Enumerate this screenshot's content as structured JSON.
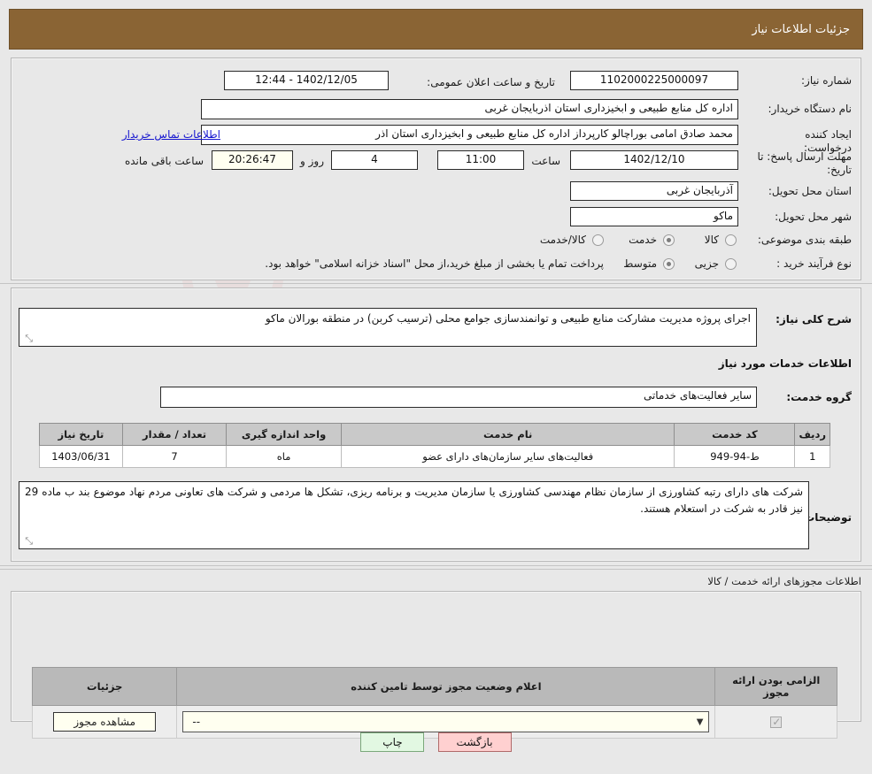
{
  "header": {
    "title": "جزئیات اطلاعات نیاز"
  },
  "form": {
    "need_number_label": "شماره نیاز:",
    "need_number_value": "1102000225000097",
    "announce_label": "تاریخ و ساعت اعلان عمومی:",
    "announce_value": "1402/12/05 - 12:44",
    "buyer_org_label": "نام دستگاه خریدار:",
    "buyer_org_value": "اداره کل منابع طبیعی و ابخیزداری استان اذربایجان غربی",
    "creator_label": "ایجاد کننده درخواست:",
    "creator_value": "محمد صادق امامی بوراچالو کارپرداز اداره کل منابع طبیعی و ابخیزداری استان اذر",
    "contact_link": "اطلاعات تماس خریدار",
    "deadline_label": "مهلت ارسال پاسخ: تا تاریخ:",
    "deadline_date": "1402/12/10",
    "hour_label": "ساعت",
    "deadline_time": "11:00",
    "days_value": "4",
    "days_label": "روز و",
    "countdown_value": "20:26:47",
    "remaining_label": "ساعت باقی مانده",
    "province_label": "استان محل تحویل:",
    "province_value": "آذربایجان غربی",
    "city_label": "شهر محل تحویل:",
    "city_value": "ماکو",
    "category_label": "طبقه بندی موضوعی:",
    "category_options": [
      "کالا",
      "خدمت",
      "کالا/خدمت"
    ],
    "category_selected": "خدمت",
    "process_label": "نوع فرآیند خرید :",
    "process_options": [
      "جزیی",
      "متوسط"
    ],
    "process_selected": "متوسط",
    "process_note": "پرداخت تمام یا بخشی از مبلغ خرید،از محل \"اسناد خزانه اسلامی\" خواهد بود."
  },
  "description": {
    "label": "شرح کلی نیاز:",
    "value": "اجرای پروژه مدیریت مشارکت منابع طبیعی و توانمندسازی جوامع محلی (ترسیب کربن) در منطقه بورالان ماکو"
  },
  "services": {
    "section_title": "اطلاعات خدمات مورد نیاز",
    "group_label": "گروه خدمت:",
    "group_value": "سایر فعالیت‌های خدماتی",
    "columns": [
      "ردیف",
      "کد خدمت",
      "نام خدمت",
      "واحد اندازه گیری",
      "تعداد / مقدار",
      "تاریخ نیاز"
    ],
    "rows": [
      {
        "row": "1",
        "code": "ط-94-949",
        "name": "فعالیت‌های سایر سازمان‌های دارای عضو",
        "unit": "ماه",
        "quantity": "7",
        "need_date": "1403/06/31"
      }
    ]
  },
  "buyer_notes": {
    "label": "توضیحات خریدار:",
    "value": "شرکت های دارای رتبه کشاورزی از سازمان نظام مهندسی کشاورزی یا سازمان مدیریت و برنامه ریزی، تشکل ها مردمی و شرکت های تعاونی مردم نهاد موضوع بند ب ماده 29 نیز قادر به شرکت در استعلام هستند."
  },
  "permits": {
    "section_title": "اطلاعات مجوزهای ارائه خدمت / کالا",
    "columns": [
      "الزامی بودن ارائه مجوز",
      "اعلام وضعیت مجوز توسط تامین کننده",
      "جزئیات"
    ],
    "rows": [
      {
        "required_checked": true,
        "status_value": "--",
        "details_button": "مشاهده مجوز"
      }
    ]
  },
  "footer": {
    "print_label": "چاپ",
    "back_label": "بازگشت"
  },
  "watermark": {
    "text": "AriaTender.net"
  },
  "colors": {
    "header_bg": "#8a6434",
    "link": "#1515cf",
    "back_btn": "#ffd0d0",
    "print_btn": "#e2f8e2",
    "cream": "#fffff0"
  }
}
